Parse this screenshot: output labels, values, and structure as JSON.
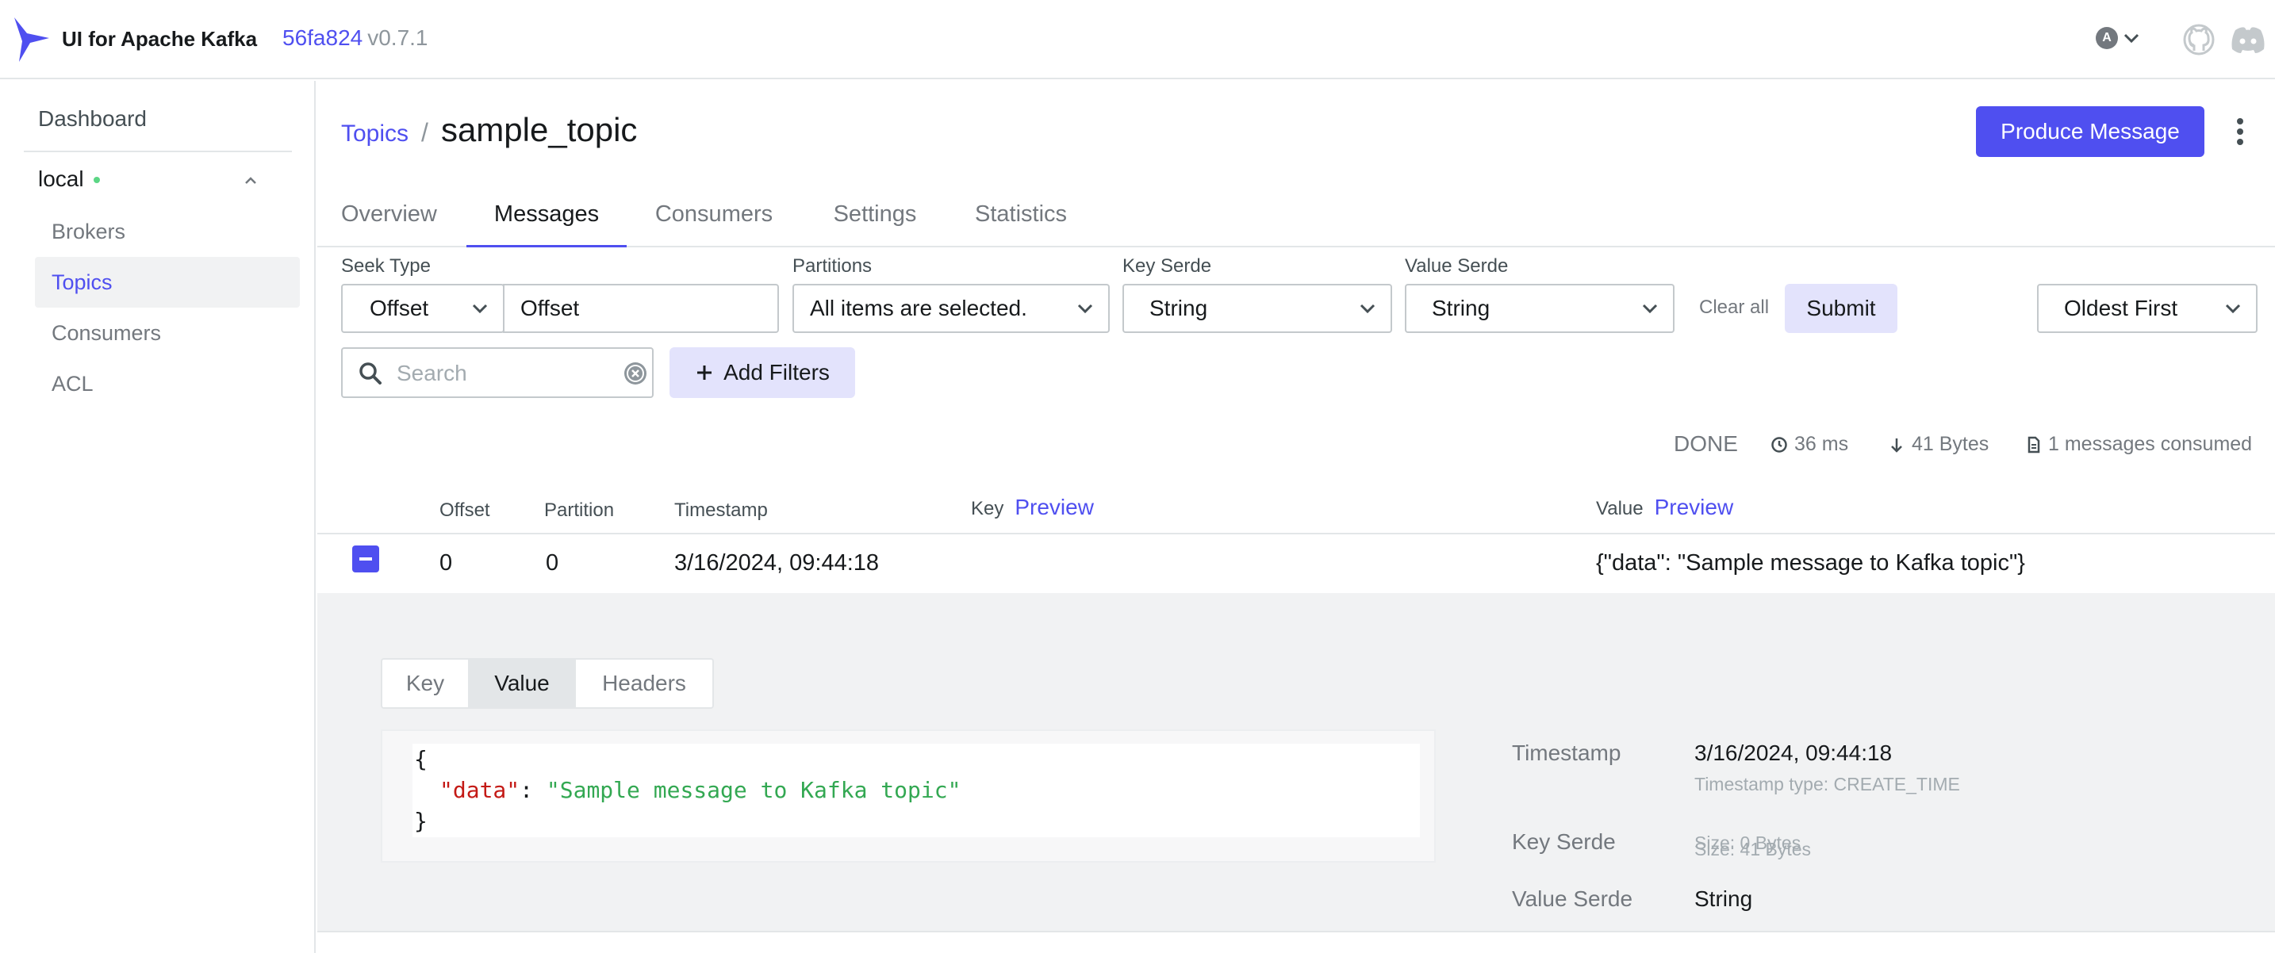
{
  "app": {
    "title": "UI for Apache Kafka",
    "commit": "56fa824",
    "version": "v0.7.1",
    "user_initial": "A"
  },
  "sidebar": {
    "dashboard": "Dashboard",
    "cluster": "local",
    "items": [
      {
        "label": "Brokers",
        "active": false
      },
      {
        "label": "Topics",
        "active": true
      },
      {
        "label": "Consumers",
        "active": false
      },
      {
        "label": "ACL",
        "active": false
      }
    ]
  },
  "header": {
    "breadcrumb_link": "Topics",
    "separator": "/",
    "title": "sample_topic",
    "produce_label": "Produce Message"
  },
  "tabs": [
    {
      "label": "Overview",
      "active": false
    },
    {
      "label": "Messages",
      "active": true
    },
    {
      "label": "Consumers",
      "active": false
    },
    {
      "label": "Settings",
      "active": false
    },
    {
      "label": "Statistics",
      "active": false
    }
  ],
  "filters": {
    "seek_type_label": "Seek Type",
    "seek_type_value": "Offset",
    "offset_value": "Offset",
    "partitions_label": "Partitions",
    "partitions_value": "All items are selected.",
    "key_serde_label": "Key Serde",
    "key_serde_value": "String",
    "value_serde_label": "Value Serde",
    "value_serde_value": "String",
    "clear_all": "Clear all",
    "submit": "Submit",
    "sort_value": "Oldest First",
    "search_placeholder": "Search",
    "add_filters": "Add Filters"
  },
  "status": {
    "state": "DONE",
    "elapsed": "36 ms",
    "bytes": "41 Bytes",
    "consumed": "1 messages consumed"
  },
  "table": {
    "headers": {
      "offset": "Offset",
      "partition": "Partition",
      "timestamp": "Timestamp",
      "key": "Key",
      "key_preview": "Preview",
      "value": "Value",
      "value_preview": "Preview"
    },
    "rows": [
      {
        "offset": "0",
        "partition": "0",
        "timestamp": "3/16/2024, 09:44:18",
        "key": "",
        "value": "{\"data\": \"Sample message to Kafka topic\"}"
      }
    ]
  },
  "detail": {
    "segments": [
      {
        "label": "Key",
        "active": false
      },
      {
        "label": "Value",
        "active": true
      },
      {
        "label": "Headers",
        "active": false
      }
    ],
    "code": {
      "open": "{",
      "key": "\"data\"",
      "colon": ": ",
      "value": "\"Sample message to Kafka topic\"",
      "close": "}"
    },
    "timestamp_label": "Timestamp",
    "timestamp_value": "3/16/2024, 09:44:18",
    "timestamp_type": "Timestamp type: CREATE_TIME",
    "key_serde_label": "Key Serde",
    "key_size": "Size: 0 Bytes",
    "value_serde_label": "Value Serde",
    "value_serde_value": "String",
    "value_size": "Size: 41 Bytes"
  }
}
